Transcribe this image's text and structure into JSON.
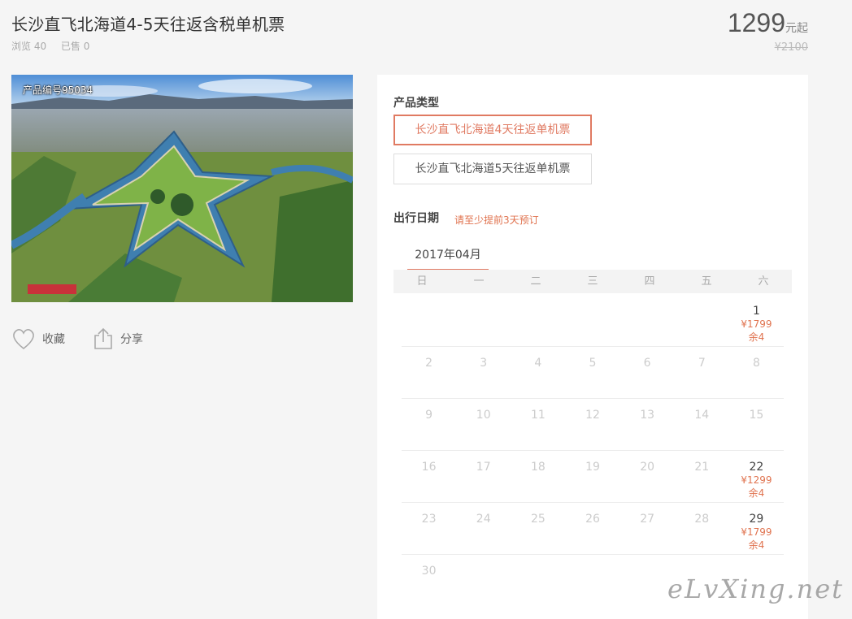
{
  "product": {
    "title": "长沙直飞北海道4-5天往返含税单机票",
    "views_label": "浏览 40",
    "sold_label": "已售 0",
    "price": "1299",
    "price_suffix": "元起",
    "original_price": "¥2100",
    "photo_code": "产品编号95034"
  },
  "actions": {
    "favorite": "收藏",
    "share": "分享"
  },
  "booking": {
    "type_label": "产品类型",
    "types": [
      {
        "label": "长沙直飞北海道4天往返单机票",
        "selected": true
      },
      {
        "label": "长沙直飞北海道5天往返单机票",
        "selected": false
      }
    ],
    "date_label": "出行日期",
    "hint": "请至少提前3天预订",
    "month": "2017年04月",
    "weekdays": [
      "日",
      "一",
      "二",
      "三",
      "四",
      "五",
      "六"
    ],
    "weeks": [
      [
        null,
        null,
        null,
        null,
        null,
        null,
        {
          "d": "1",
          "price": "¥1799",
          "left": "余4"
        }
      ],
      [
        {
          "d": "2"
        },
        {
          "d": "3"
        },
        {
          "d": "4"
        },
        {
          "d": "5"
        },
        {
          "d": "6"
        },
        {
          "d": "7"
        },
        {
          "d": "8"
        }
      ],
      [
        {
          "d": "9"
        },
        {
          "d": "10"
        },
        {
          "d": "11"
        },
        {
          "d": "12"
        },
        {
          "d": "13"
        },
        {
          "d": "14"
        },
        {
          "d": "15"
        }
      ],
      [
        {
          "d": "16"
        },
        {
          "d": "17"
        },
        {
          "d": "18"
        },
        {
          "d": "19"
        },
        {
          "d": "20"
        },
        {
          "d": "21"
        },
        {
          "d": "22",
          "price": "¥1299",
          "left": "余4"
        }
      ],
      [
        {
          "d": "23"
        },
        {
          "d": "24"
        },
        {
          "d": "25"
        },
        {
          "d": "26"
        },
        {
          "d": "27"
        },
        {
          "d": "28"
        },
        {
          "d": "29",
          "price": "¥1799",
          "left": "余4"
        }
      ],
      [
        {
          "d": "30"
        },
        null,
        null,
        null,
        null,
        null,
        null
      ]
    ]
  },
  "watermark": "eLvXing.net",
  "colors": {
    "accent": "#e07a62",
    "background": "#f5f5f5"
  }
}
